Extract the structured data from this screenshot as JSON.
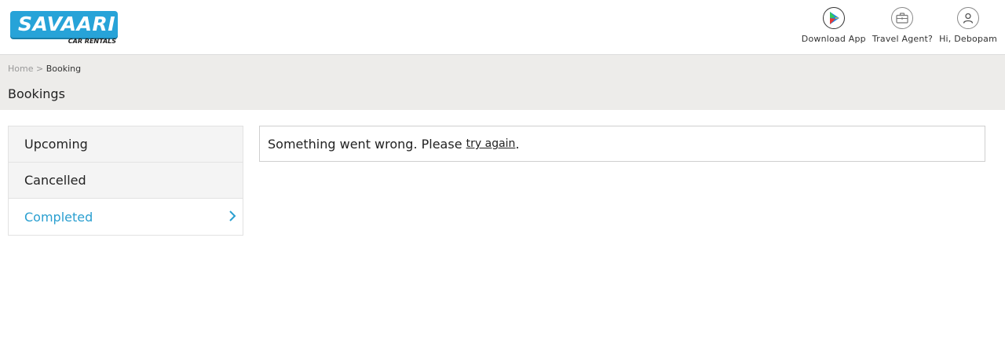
{
  "logo": {
    "brand": "SAVAARI",
    "tagline": "CAR RENTALS"
  },
  "header": {
    "actions": [
      {
        "label": "Download App",
        "icon": "play-store-icon"
      },
      {
        "label": "Travel Agent?",
        "icon": "briefcase-icon"
      },
      {
        "label": "Hi, Debopam",
        "icon": "user-icon"
      }
    ]
  },
  "breadcrumb": {
    "home": "Home",
    "separator": ">",
    "current": "Booking"
  },
  "page": {
    "title": "Bookings"
  },
  "sidebar": {
    "items": [
      {
        "label": "Upcoming",
        "active": false
      },
      {
        "label": "Cancelled",
        "active": false
      },
      {
        "label": "Completed",
        "active": true
      }
    ]
  },
  "panel": {
    "message": "Something went wrong. Please",
    "link": "try again",
    "suffix": "."
  },
  "colors": {
    "accent": "#2a9fd0",
    "logo_bg": "#27a3d8",
    "subheader_bg": "#edecea"
  }
}
